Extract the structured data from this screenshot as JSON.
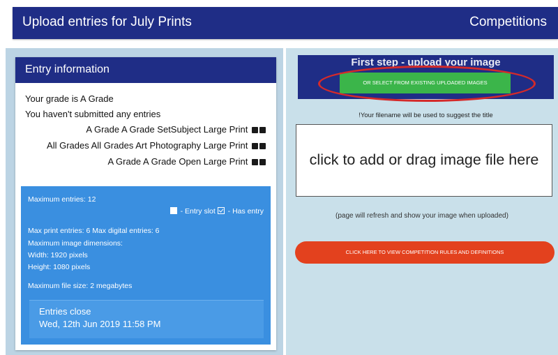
{
  "header": {
    "title": "Upload entries for July Prints",
    "section": "Competitions"
  },
  "entry_info": {
    "title": "Entry information",
    "grade_text": "Your grade is A Grade",
    "submitted_text": "You haven't submitted any entries",
    "classes": [
      "A Grade A Grade SetSubject Large Print",
      "All Grades All Grades Art Photography Large Print",
      "A Grade A Grade Open Large Print"
    ]
  },
  "limits": {
    "max_entries": "Maximum entries: 12",
    "legend_slot": " - Entry slot",
    "legend_entry": " - Has entry",
    "max_print_digital": "Max print entries: 6 Max digital entries: 6",
    "max_dimensions": "Maximum image dimensions:",
    "width": "Width: 1920 pixels",
    "height": "Height: 1080 pixels",
    "max_file_size": "Maximum file size: 2 megabytes",
    "entries_close_label": "Entries close",
    "entries_close_date": "Wed, 12th Jun 2019 11:58 PM"
  },
  "upload": {
    "step_title": "First step - upload your image",
    "select_existing_button": "OR SELECT FROM EXISTING UPLOADED IMAGES",
    "filename_hint": "!Your filename will be used to suggest the title",
    "drop_text": "click to add or drag image file here",
    "refresh_note": "(page will refresh and show your image when uploaded)",
    "rules_button": "CLICK HERE TO VIEW COMPETITION RULES AND DEFINITIONS"
  },
  "colors": {
    "header_navy": "#1f2d86",
    "info_blue": "#3a8fe0",
    "select_green": "#3bb54a",
    "rules_red": "#e3411e",
    "highlight_oval": "#d42a2a"
  }
}
